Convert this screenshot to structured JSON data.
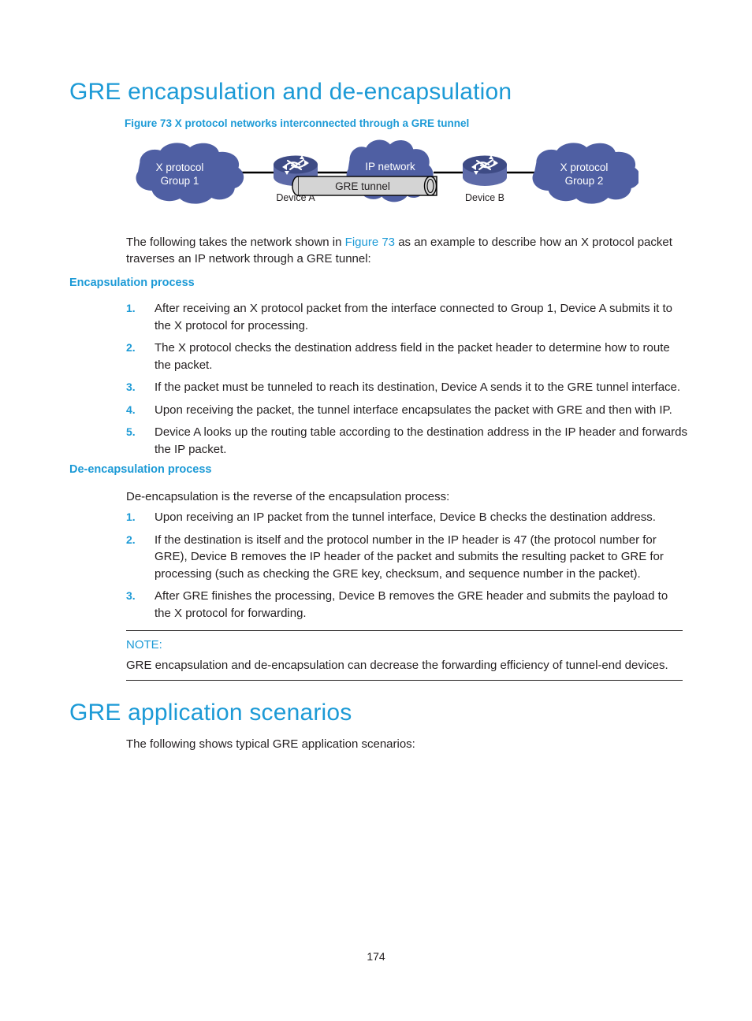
{
  "document": {
    "page_number": "174"
  },
  "sections": {
    "encapsulation": {
      "heading": "GRE encapsulation and de-encapsulation",
      "figure_caption": "Figure 73 X protocol networks interconnected through a GRE tunnel",
      "intro_before_link": "The following takes the network shown in ",
      "intro_link": "Figure 73",
      "intro_after_link": " as an example to describe how an X protocol packet traverses an IP network through a GRE tunnel:",
      "encapsulation_heading": "Encapsulation process",
      "encapsulation_steps": [
        {
          "num": "1.",
          "text": "After receiving an X protocol packet from the interface connected to Group 1, Device A submits it to the X protocol for processing."
        },
        {
          "num": "2.",
          "text": "The X protocol checks the destination address field in the packet header to determine how to route the packet."
        },
        {
          "num": "3.",
          "text": "If the packet must be tunneled to reach its destination, Device A sends it to the GRE tunnel interface."
        },
        {
          "num": "4.",
          "text": "Upon receiving the packet, the tunnel interface encapsulates the packet with GRE and then with IP."
        },
        {
          "num": "5.",
          "text": "Device A looks up the routing table according to the destination address in the IP header and forwards the IP packet."
        }
      ],
      "deencapsulation_heading": "De-encapsulation process",
      "deencapsulation_lead": "De-encapsulation is the reverse of the encapsulation process:",
      "deencapsulation_steps": [
        {
          "num": "1.",
          "text": "Upon receiving an IP packet from the tunnel interface, Device B checks the destination address."
        },
        {
          "num": "2.",
          "text": "If the destination is itself and the protocol number in the IP header is 47 (the protocol number for GRE), Device B removes the IP header of the packet and submits the resulting packet to GRE for processing (such as checking the GRE key, checksum, and sequence number in the packet)."
        },
        {
          "num": "3.",
          "text": "After GRE finishes the processing, Device B removes the GRE header and submits the payload to the X protocol for forwarding."
        }
      ],
      "note": {
        "label": "NOTE:",
        "text": "GRE encapsulation and de-encapsulation can decrease the forwarding efficiency of tunnel-end devices."
      }
    },
    "application": {
      "heading": "GRE application scenarios",
      "lead": "The following shows typical GRE application scenarios:"
    }
  },
  "figure": {
    "cloud_left_line1": "X protocol",
    "cloud_left_line2": "Group 1",
    "cloud_middle": "IP network",
    "cloud_right_line1": "X protocol",
    "cloud_right_line2": "Group 2",
    "tunnel_label": "GRE tunnel",
    "device_a_label": "Device A",
    "device_b_label": "Device B"
  },
  "colors": {
    "heading_blue": "#1c9ad6",
    "cloud_fill": "#4f5fa3",
    "router_top": "#3f4d86",
    "router_body": "#6b79b4",
    "tunnel_fill": "#d4d4d4",
    "text_black": "#231f20"
  }
}
